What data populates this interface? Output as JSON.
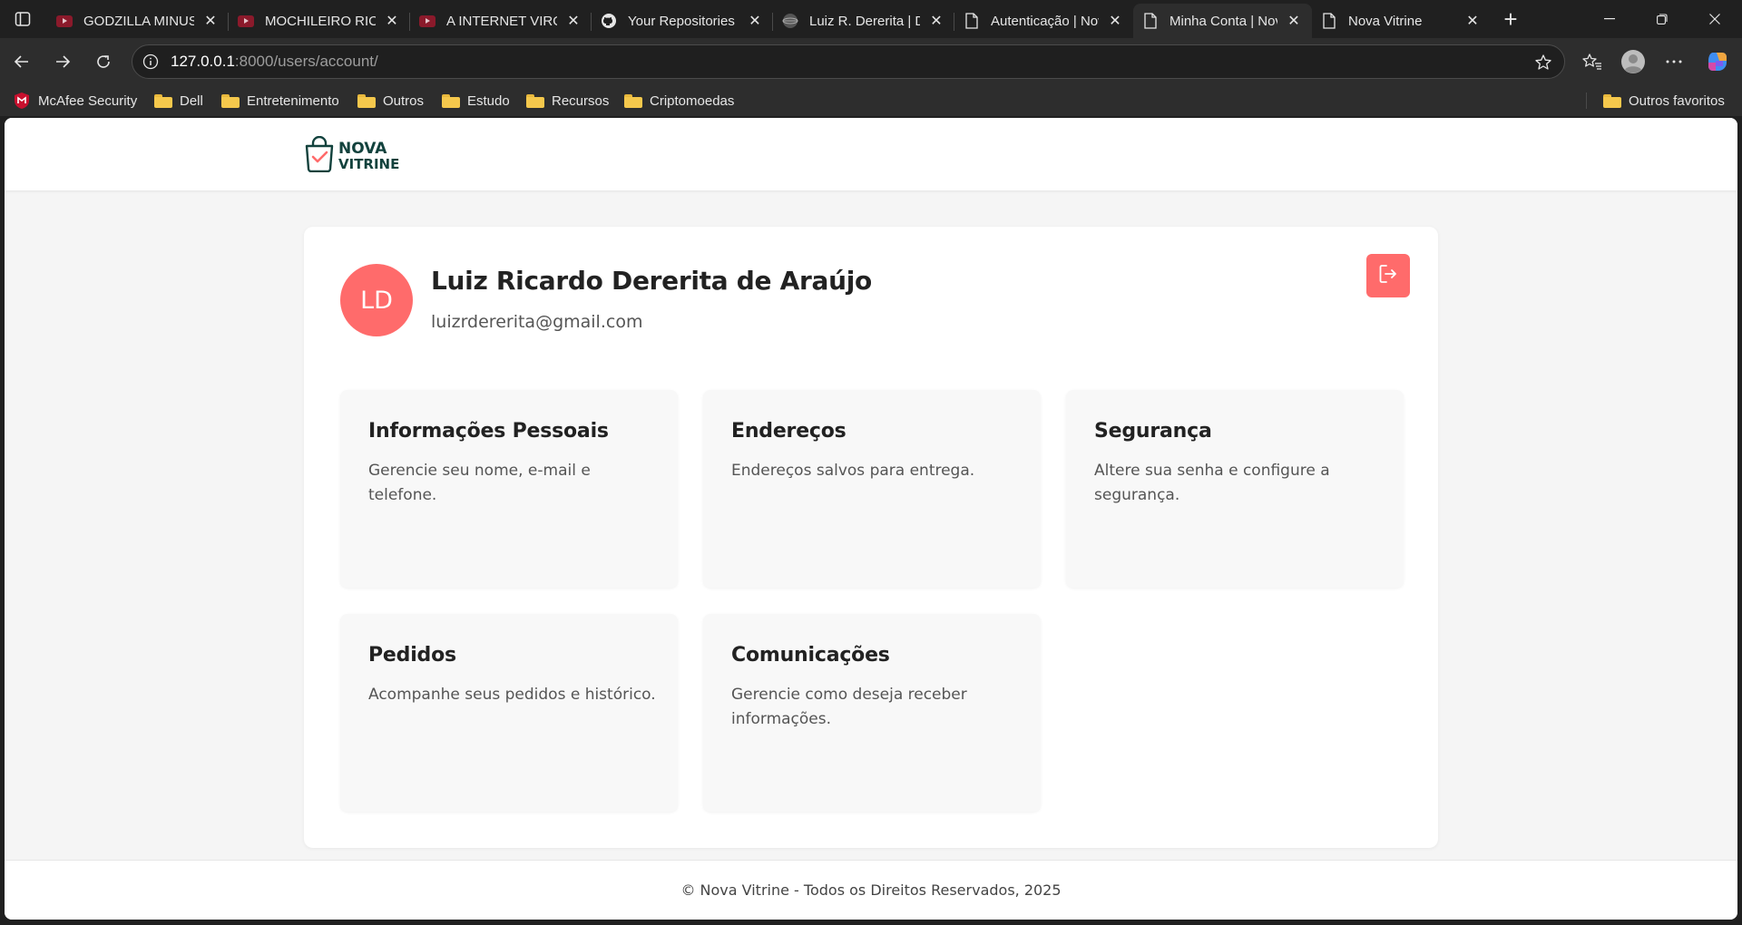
{
  "browser": {
    "tabs": [
      {
        "title": "GODZILLA MINUS",
        "favicon": "youtube-icon"
      },
      {
        "title": "MOCHILEIRO RICK",
        "favicon": "youtube-icon"
      },
      {
        "title": "A INTERNET VIROU",
        "favicon": "youtube-icon"
      },
      {
        "title": "Your Repositories",
        "favicon": "github-icon"
      },
      {
        "title": "Luiz R. Dererita | D",
        "favicon": "globe-icon"
      },
      {
        "title": "Autenticação | Nov",
        "favicon": "page-icon"
      },
      {
        "title": "Minha Conta | Nov",
        "favicon": "page-icon",
        "active": true
      },
      {
        "title": "Nova Vitrine",
        "favicon": "page-icon"
      }
    ],
    "address": {
      "host": "127.0.0.1",
      "path": ":8000/users/account/"
    },
    "bookmarks": [
      {
        "label": "McAfee Security",
        "icon": "mcafee-icon"
      },
      {
        "label": "Dell",
        "icon": "folder-icon"
      },
      {
        "label": "Entretenimento",
        "icon": "folder-icon"
      },
      {
        "label": "Outros",
        "icon": "folder-icon"
      },
      {
        "label": "Estudo",
        "icon": "folder-icon"
      },
      {
        "label": "Recursos",
        "icon": "folder-icon"
      },
      {
        "label": "Criptomoedas",
        "icon": "folder-icon"
      }
    ],
    "other_favorites": "Outros favoritos"
  },
  "site": {
    "logo": {
      "line1": "NOVA",
      "line2": "VITRINE"
    },
    "colors": {
      "accent": "#ff6b6b",
      "brand": "#12423d"
    },
    "profile": {
      "initials": "LD",
      "name": "Luiz Ricardo Dererita de Araújo",
      "email": "luizrdererita@gmail.com"
    },
    "sections": [
      {
        "title": "Informações Pessoais",
        "description": "Gerencie seu nome, e-mail e telefone."
      },
      {
        "title": "Endereços",
        "description": "Endereços salvos para entrega."
      },
      {
        "title": "Segurança",
        "description": "Altere sua senha e configure a segurança."
      },
      {
        "title": "Pedidos",
        "description": "Acompanhe seus pedidos e histórico."
      },
      {
        "title": "Comunicações",
        "description": "Gerencie como deseja receber informações."
      }
    ],
    "footer": "© Nova Vitrine - Todos os Direitos Reservados, 2025"
  }
}
